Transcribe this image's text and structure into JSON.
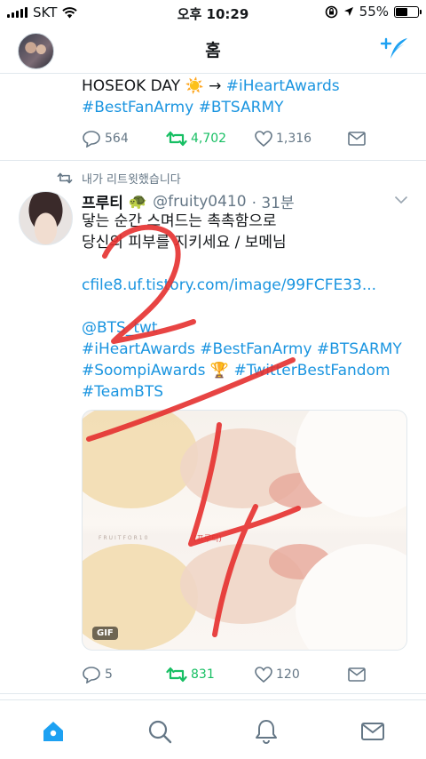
{
  "status_bar": {
    "carrier": "SKT",
    "time": "오후 10:29",
    "battery": "55%",
    "battery_level": 0.55,
    "icons": [
      "signal-icon",
      "wifi-icon",
      "orientation-lock-icon",
      "location-icon",
      "battery-icon"
    ]
  },
  "header": {
    "title": "홈",
    "compose_icon": "compose-tweet-icon"
  },
  "tweet1": {
    "line1_text": "HOSEOK DAY ",
    "line1_arrow": " → ",
    "line1_tag": "#iHeartAwards",
    "line2": "#BestFanArmy #BTSARMY",
    "replies": "564",
    "retweets": "4,702",
    "likes": "1,316"
  },
  "tweet2": {
    "retweet_label": "내가 리트윗했습니다",
    "name": "프루티",
    "handle": "@fruity0410",
    "time": "· 31분",
    "line1": "닿는 순간 스며드는 촉촉함으로",
    "line2": "당신의 피부를 지키세요 / 보메님",
    "url": "cfile8.uf.tistory.com/image/99FCFE33...",
    "mention": "@BTS_twt",
    "tags1": "#iHeartAwards #BestFanArmy #BTSARMY",
    "tags2a": "#SoompiAwards",
    "tags2b": "#TwitterBestFandom",
    "tags3": "#TeamBTS",
    "media_watermark": "FRUITFOR10",
    "media_watermark2": "(프루티)",
    "gif_badge": "GIF",
    "replies": "5",
    "retweets": "831",
    "likes": "120"
  },
  "annotations": {
    "number_1": "2",
    "number_2": "4",
    "color": "#e5302f"
  },
  "tab_bar": {
    "tabs": [
      "home-tab",
      "search-tab",
      "notifications-tab",
      "messages-tab"
    ],
    "active": "home-tab"
  },
  "colors": {
    "accent": "#1da1f2",
    "link": "#1b95e0",
    "retweet": "#17bf63",
    "muted": "#657786"
  }
}
